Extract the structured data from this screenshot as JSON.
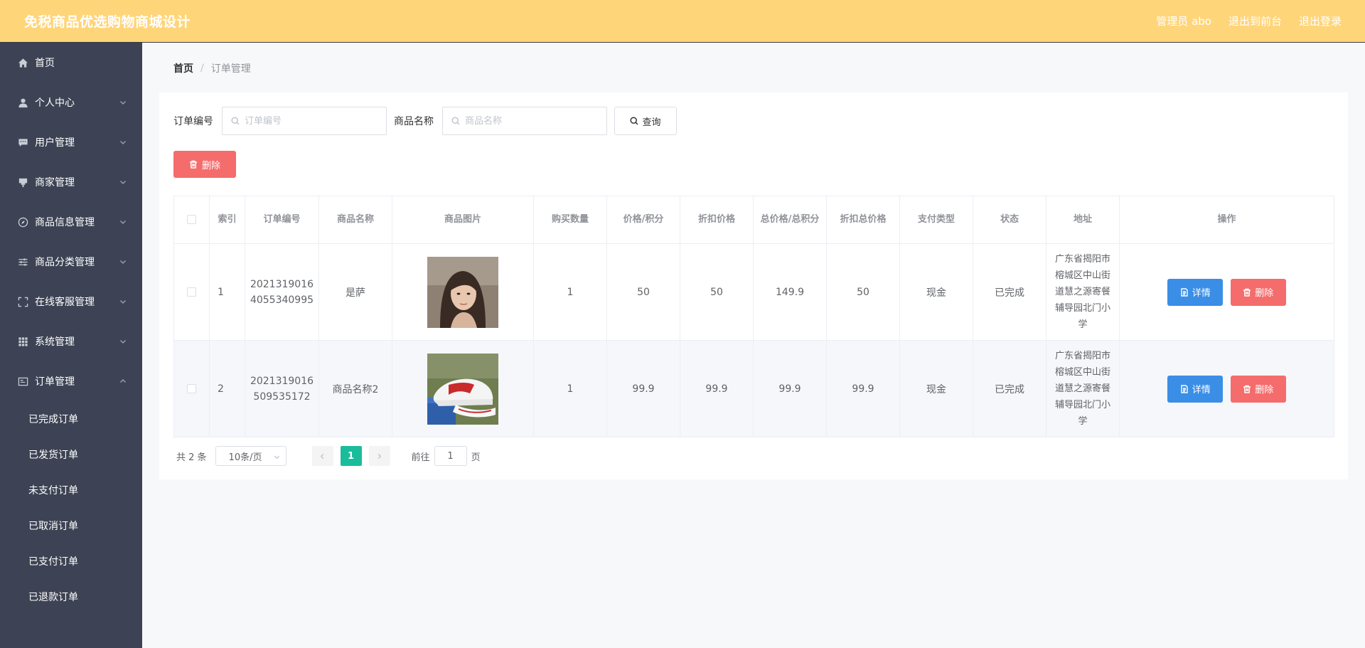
{
  "header": {
    "title": "免税商品优选购物商城设计",
    "user_label": "管理员 abo",
    "front_link": "退出到前台",
    "logout_link": "退出登录"
  },
  "sidebar": {
    "items": [
      {
        "label": "首页",
        "icon": "home-icon",
        "has_chevron": false
      },
      {
        "label": "个人中心",
        "icon": "user-icon",
        "has_chevron": true
      },
      {
        "label": "用户管理",
        "icon": "chat-icon",
        "has_chevron": true
      },
      {
        "label": "商家管理",
        "icon": "shop-icon",
        "has_chevron": true
      },
      {
        "label": "商品信息管理",
        "icon": "compass-icon",
        "has_chevron": true
      },
      {
        "label": "商品分类管理",
        "icon": "sliders-icon",
        "has_chevron": true
      },
      {
        "label": "在线客服管理",
        "icon": "fullscreen-icon",
        "has_chevron": true
      },
      {
        "label": "系统管理",
        "icon": "grid-icon",
        "has_chevron": true
      },
      {
        "label": "订单管理",
        "icon": "order-icon",
        "has_chevron": true,
        "expanded": true
      }
    ],
    "sub_items": [
      "已完成订单",
      "已发货订单",
      "未支付订单",
      "已取消订单",
      "已支付订单",
      "已退款订单"
    ]
  },
  "breadcrumb": {
    "home": "首页",
    "separator": "/",
    "current": "订单管理"
  },
  "search": {
    "order_no_label": "订单编号",
    "order_no_placeholder": "订单编号",
    "order_no_value": "",
    "product_label": "商品名称",
    "product_placeholder": "商品名称",
    "product_value": "",
    "query_button": "查询"
  },
  "toolbar": {
    "delete_label": "删除"
  },
  "table": {
    "columns": [
      "",
      "索引",
      "订单编号",
      "商品名称",
      "商品图片",
      "购买数量",
      "价格/积分",
      "折扣价格",
      "总价格/总积分",
      "折扣总价格",
      "支付类型",
      "状态",
      "地址",
      "操作"
    ],
    "rows": [
      {
        "index": "1",
        "order_no": "20213190164055340995",
        "product_name": "是萨",
        "image": "portrait-photo",
        "quantity": "1",
        "price": "50",
        "discount_price": "50",
        "total_price": "149.9",
        "discount_total": "50",
        "pay_type": "现金",
        "status": "已完成",
        "address": "广东省揭阳市榕城区中山街道慧之源寄餐辅导园北门小学"
      },
      {
        "index": "2",
        "order_no": "2021319016509535172",
        "product_name": "商品名称2",
        "image": "sneaker-photo",
        "quantity": "1",
        "price": "99.9",
        "discount_price": "99.9",
        "total_price": "99.9",
        "discount_total": "99.9",
        "pay_type": "现金",
        "status": "已完成",
        "address": "广东省揭阳市榕城区中山街道慧之源寄餐辅导园北门小学"
      }
    ],
    "detail_label": "详情",
    "delete_label": "删除"
  },
  "pagination": {
    "total_text": "共 2 条",
    "page_size": "10条/页",
    "current_page": "1",
    "goto_label": "前往",
    "goto_value": "1",
    "page_unit": "页"
  },
  "colors": {
    "header_bg": "#ffd57a",
    "sidebar_bg": "#3d4354",
    "danger": "#f56c6c",
    "primary": "#3a8ee6",
    "page_active": "#1abc9c"
  }
}
